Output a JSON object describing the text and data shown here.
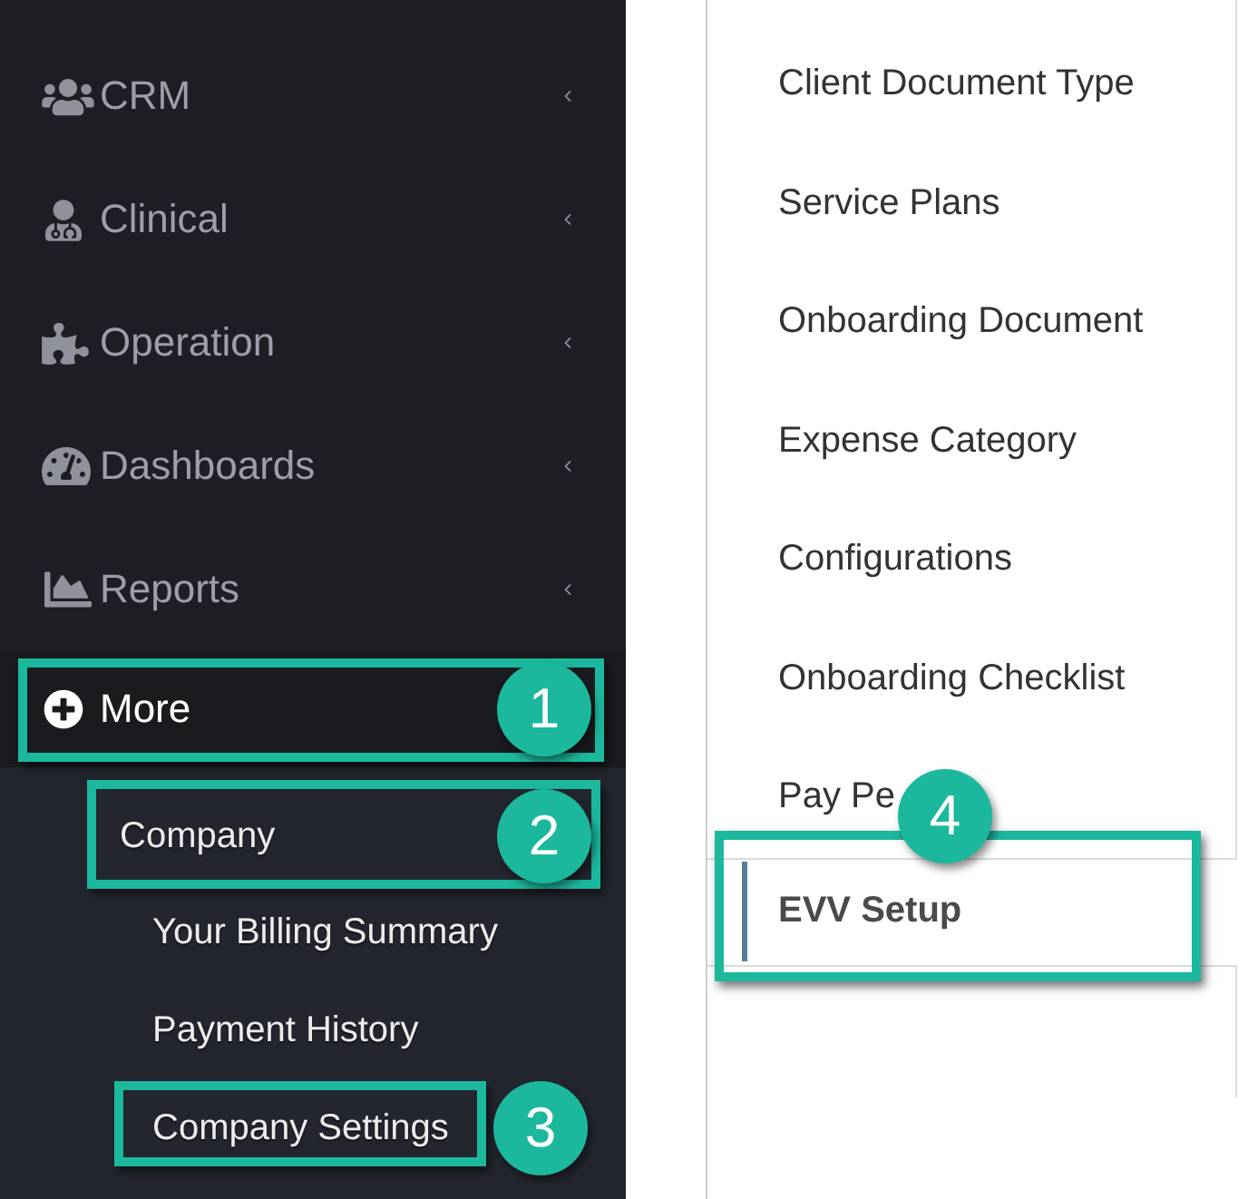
{
  "sidebar": {
    "items": [
      {
        "label": "CRM",
        "selected": false,
        "expanded": false
      },
      {
        "label": "Clinical",
        "selected": false,
        "expanded": false
      },
      {
        "label": "Operation",
        "selected": false,
        "expanded": false
      },
      {
        "label": "Dashboards",
        "selected": false,
        "expanded": false
      },
      {
        "label": "Reports",
        "selected": false,
        "expanded": false
      },
      {
        "label": "More",
        "selected": true,
        "expanded": true,
        "step": "1",
        "children": [
          {
            "label": "Company",
            "step": "2",
            "children": [
              {
                "label": "Your Billing Summary"
              },
              {
                "label": "Payment History"
              },
              {
                "label": "Company Settings",
                "step": "3"
              }
            ]
          }
        ]
      }
    ]
  },
  "settings_menu": {
    "items": [
      {
        "label": "Client Document Type",
        "selected": false
      },
      {
        "label": "Service Plans",
        "selected": false
      },
      {
        "label": "Onboarding Document",
        "selected": false
      },
      {
        "label": "Expense Category",
        "selected": false
      },
      {
        "label": "Configurations",
        "selected": false
      },
      {
        "label": "Onboarding Checklist",
        "selected": false
      },
      {
        "label": "Pay Pe",
        "selected": false
      },
      {
        "label": "EVV Setup",
        "selected": true,
        "step": "4"
      }
    ]
  }
}
